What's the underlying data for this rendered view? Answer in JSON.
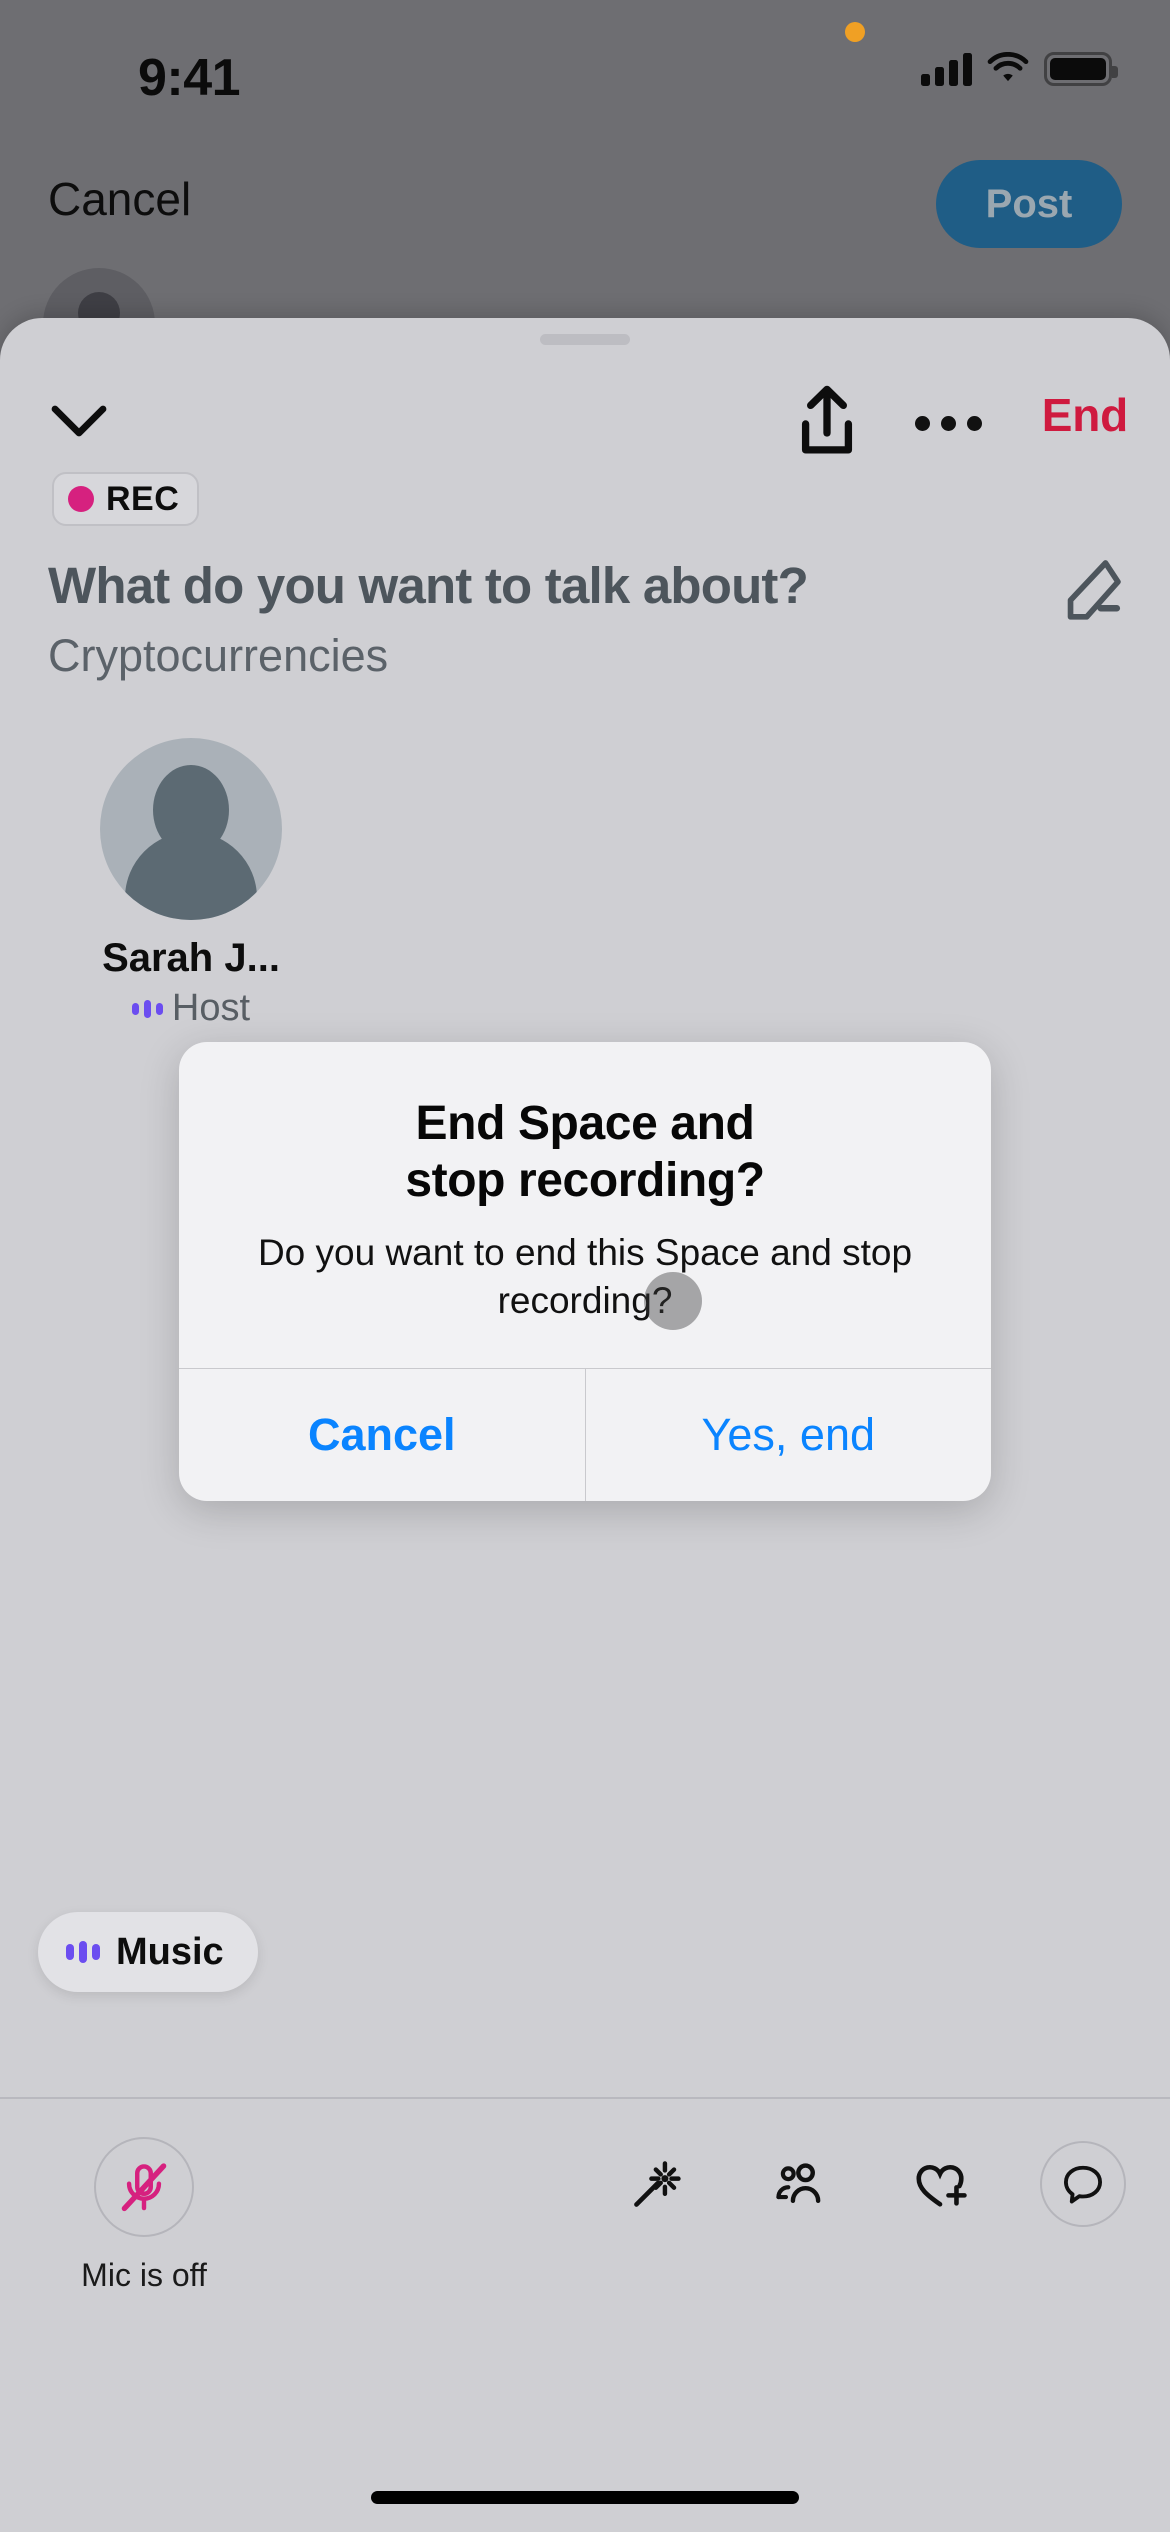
{
  "status_bar": {
    "time": "9:41",
    "icons": [
      "orange-recording-dot",
      "cellular-signal-icon",
      "wifi-icon",
      "battery-icon"
    ]
  },
  "compose_screen": {
    "cancel_label": "Cancel",
    "post_label": "Post",
    "avatar": "compose-avatar"
  },
  "sheet": {
    "header": {
      "collapse_icon": "chevron-down-icon",
      "share_icon": "share-icon",
      "more_icon": "more-horizontal-icon",
      "end_label": "End"
    },
    "recording_badge": {
      "label": "REC",
      "dot_color": "#d6217f"
    },
    "title": "What do you want to talk about?",
    "topic": "Cryptocurrencies",
    "edit_icon": "pencil-edit-icon",
    "speaker": {
      "name": "Sarah J...",
      "role": "Host",
      "speaking_indicator": "audio-wave-icon"
    },
    "music_pill": {
      "label": "Music",
      "icon": "audio-wave-icon"
    }
  },
  "toolbar": {
    "mic": {
      "icon": "mic-off-icon",
      "label": "Mic is off",
      "color": "#d6217f"
    },
    "actions": [
      {
        "name": "magic-wand-icon",
        "label": "Effects"
      },
      {
        "name": "people-icon",
        "label": "Guests"
      },
      {
        "name": "heart-plus-icon",
        "label": "React"
      },
      {
        "name": "chat-bubble-icon",
        "label": "Chat"
      }
    ]
  },
  "alert": {
    "title": "End Space and\nstop recording?",
    "message": "Do you want to end this Space and stop recording?",
    "cancel_label": "Cancel",
    "confirm_label": "Yes, end",
    "accent_color": "#0a84ff"
  },
  "colors": {
    "end_red": "#cf1a3f",
    "post_blue": "#1f5d86",
    "accent_purple": "#6b4df0",
    "rec_pink": "#d6217f",
    "sheet_bg": "#cfcfd3",
    "backdrop": "#6e6e72"
  }
}
